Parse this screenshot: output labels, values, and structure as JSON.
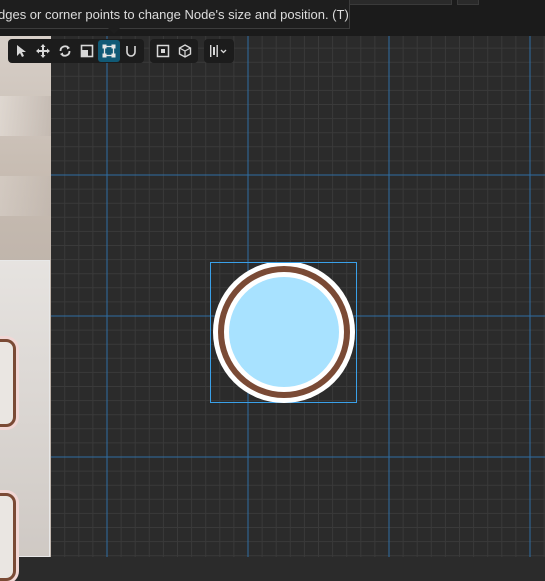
{
  "tooltip": {
    "text": "dges or corner points to change Node's size and position. (T)"
  },
  "toolbar": {
    "groups": [
      {
        "tools": [
          {
            "name": "select-tool",
            "icon": "arrow-icon"
          },
          {
            "name": "move-tool",
            "icon": "move-icon"
          },
          {
            "name": "rotate-tool",
            "icon": "rotate-icon"
          },
          {
            "name": "scale-tool",
            "icon": "scale-icon"
          },
          {
            "name": "rect-tool",
            "icon": "rect-transform-icon",
            "active": true
          },
          {
            "name": "snap-tool",
            "icon": "magnet-icon"
          }
        ]
      },
      {
        "tools": [
          {
            "name": "pivot-tool",
            "icon": "pivot-icon"
          },
          {
            "name": "space-tool",
            "icon": "cube-icon"
          }
        ]
      },
      {
        "tools": [
          {
            "name": "align-tool",
            "icon": "align-icon",
            "has_dropdown": true
          }
        ]
      }
    ]
  },
  "node": {
    "fill_color": "#a8e2ff",
    "ring_color": "#7a4a35",
    "outline_color": "#ffffff",
    "selection_color": "#3aa0e8"
  },
  "colors": {
    "background": "#2b2b2b",
    "grid_major": "#2f6ea3",
    "grid_minor": "#3a3a3a",
    "active_tool": "#115a76"
  }
}
